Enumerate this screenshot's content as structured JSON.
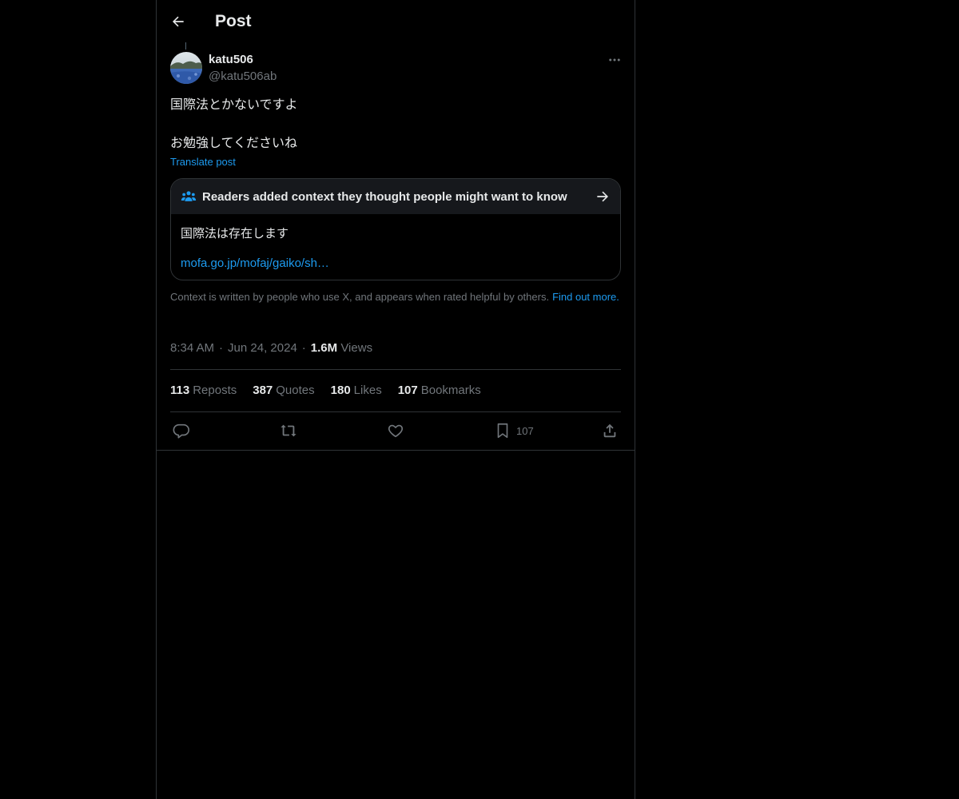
{
  "header": {
    "title": "Post"
  },
  "author": {
    "display_name": "katu506",
    "handle": "@katu506ab"
  },
  "post": {
    "line1": "国際法とかないですよ",
    "line2": "お勉強してくださいね",
    "translate_label": "Translate post"
  },
  "community_note": {
    "title": "Readers added context they thought people might want to know",
    "body": "国際法は存在します",
    "link": "mofa.go.jp/mofaj/gaiko/sh…",
    "footer": "Context is written by people who use X, and appears when rated helpful by others.",
    "find_out_more": "Find out more."
  },
  "meta": {
    "time": "8:34 AM",
    "date": "Jun 24, 2024",
    "views_count": "1.6M",
    "views_label": "Views"
  },
  "stats": {
    "reposts_count": "113",
    "reposts_label": "Reposts",
    "quotes_count": "387",
    "quotes_label": "Quotes",
    "likes_count": "180",
    "likes_label": "Likes",
    "bookmarks_count": "107",
    "bookmarks_label": "Bookmarks"
  },
  "actions": {
    "bookmark_count": "107"
  },
  "colors": {
    "background": "#000000",
    "text": "#e7e9ea",
    "muted": "#71767b",
    "accent": "#1d9bf0",
    "border": "#2f3336"
  },
  "icons": {
    "back": "arrow-left-icon",
    "more": "more-horizontal-icon",
    "note": "people-icon",
    "note_arrow": "arrow-right-icon",
    "reply": "reply-icon",
    "repost": "repost-icon",
    "like": "heart-icon",
    "bookmark": "bookmark-icon",
    "share": "share-icon"
  }
}
